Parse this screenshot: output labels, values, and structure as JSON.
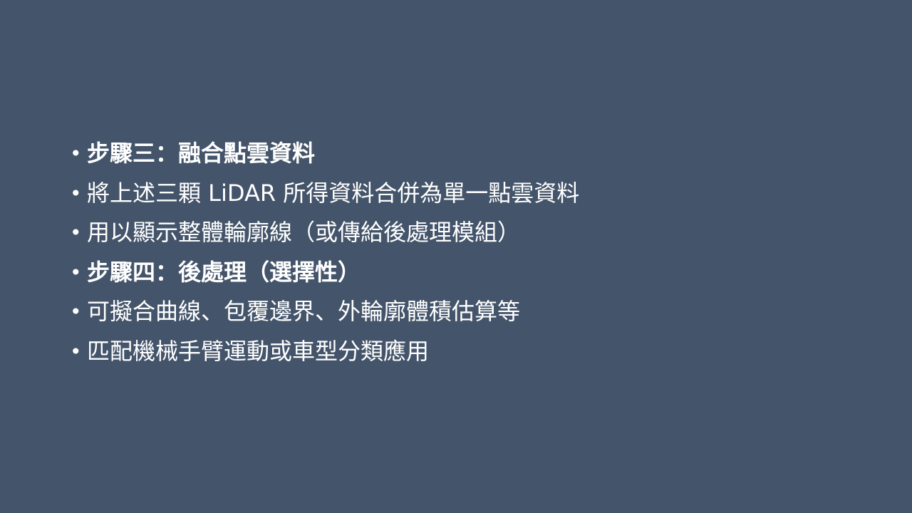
{
  "slide": {
    "bullets": [
      {
        "text": "步驟三：融合點雲資料",
        "bold": true
      },
      {
        "text": "將上述三顆 LiDAR 所得資料合併為單一點雲資料",
        "bold": false
      },
      {
        "text": "用以顯示整體輪廓線（或傳給後處理模組）",
        "bold": false
      },
      {
        "text": "步驟四：後處理（選擇性）",
        "bold": true
      },
      {
        "text": "可擬合曲線、包覆邊界、外輪廓體積估算等",
        "bold": false
      },
      {
        "text": "匹配機械手臂運動或車型分類應用",
        "bold": false
      }
    ],
    "bullet_symbol": "•",
    "colors": {
      "background": "#44546a",
      "text": "#ffffff"
    }
  }
}
